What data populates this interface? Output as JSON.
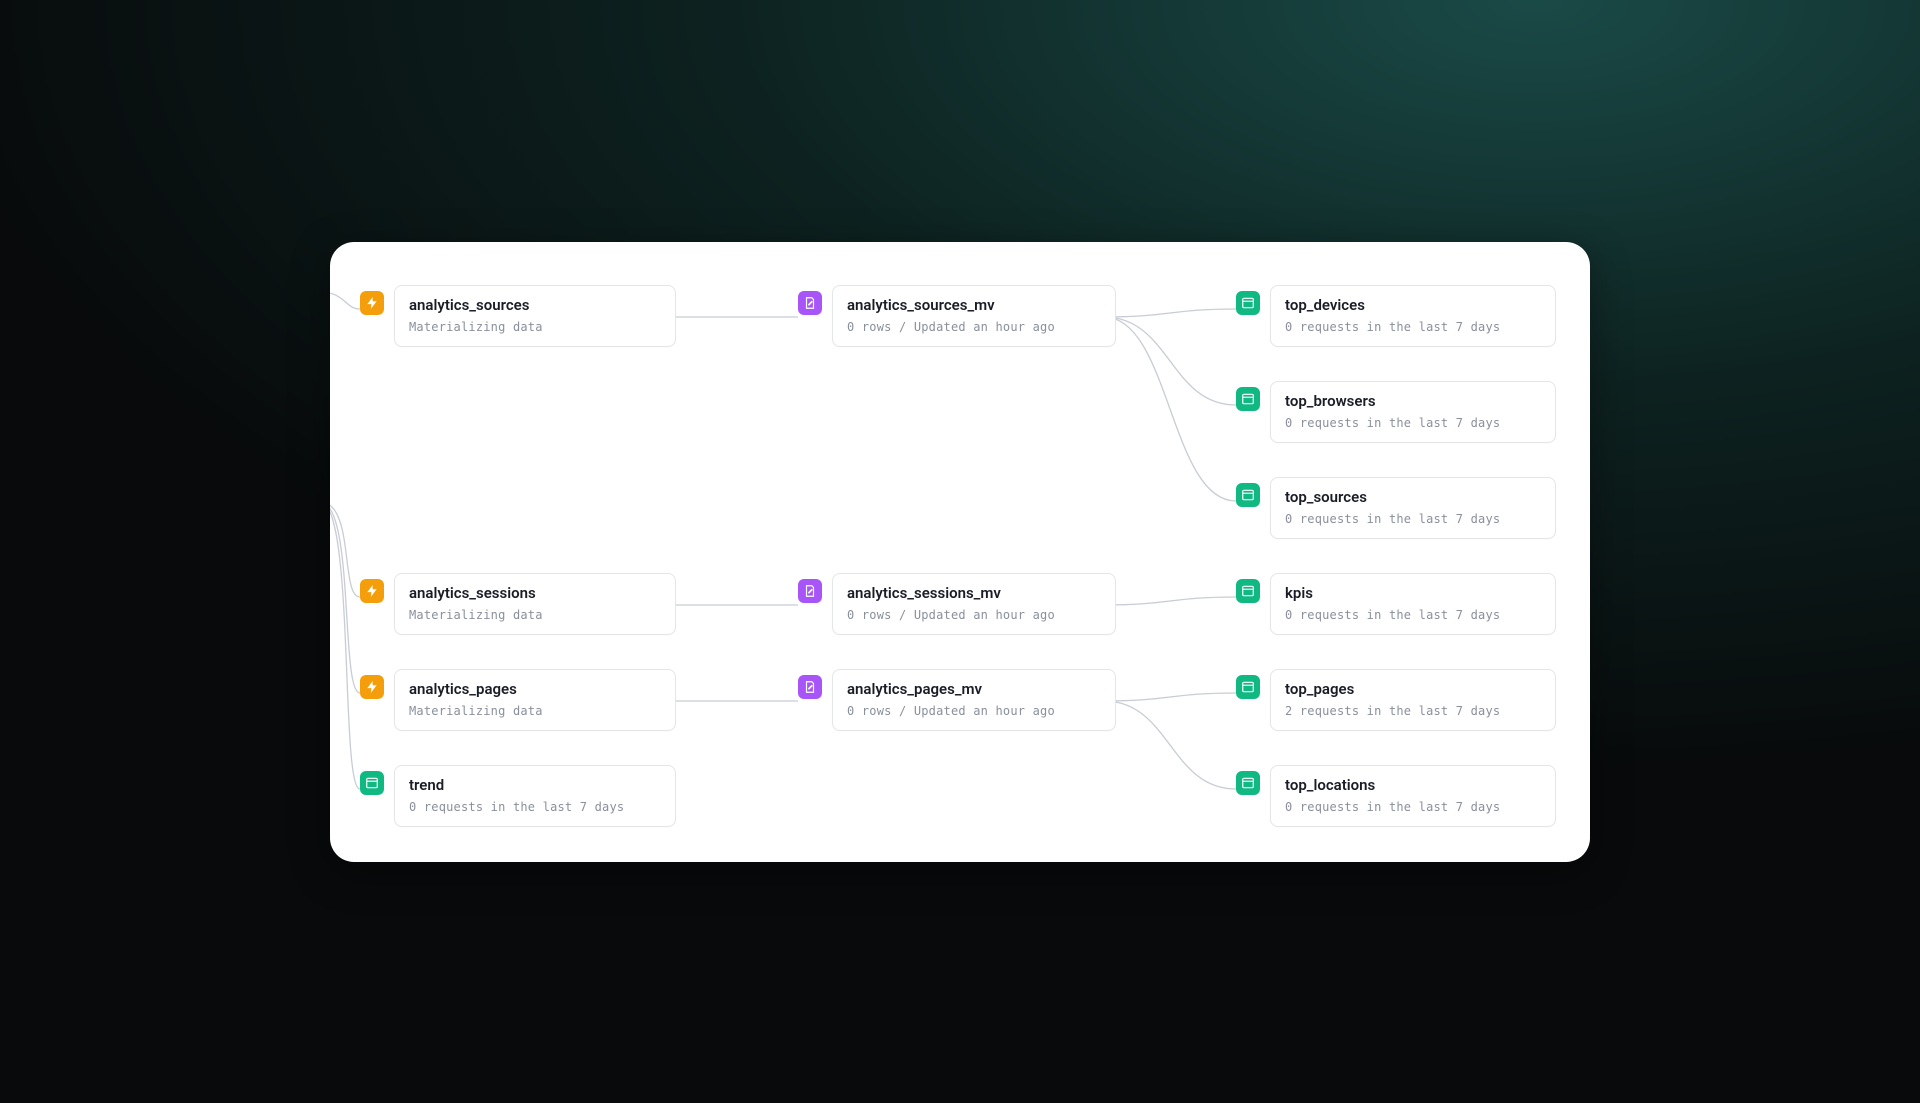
{
  "col1": {
    "analytics_sources": {
      "title": "analytics_sources",
      "subtitle": "Materializing data"
    },
    "analytics_sessions": {
      "title": "analytics_sessions",
      "subtitle": "Materializing data"
    },
    "analytics_pages": {
      "title": "analytics_pages",
      "subtitle": "Materializing data"
    },
    "trend": {
      "title": "trend",
      "subtitle": "0 requests in the last 7 days"
    }
  },
  "col2": {
    "analytics_sources_mv": {
      "title": "analytics_sources_mv",
      "subtitle": "0 rows / Updated an hour ago"
    },
    "analytics_sessions_mv": {
      "title": "analytics_sessions_mv",
      "subtitle": "0 rows / Updated an hour ago"
    },
    "analytics_pages_mv": {
      "title": "analytics_pages_mv",
      "subtitle": "0 rows / Updated an hour ago"
    }
  },
  "col3": {
    "top_devices": {
      "title": "top_devices",
      "subtitle": "0 requests in the last 7 days"
    },
    "top_browsers": {
      "title": "top_browsers",
      "subtitle": "0 requests in the last 7 days"
    },
    "top_sources": {
      "title": "top_sources",
      "subtitle": "0 requests in the last 7 days"
    },
    "kpis": {
      "title": "kpis",
      "subtitle": "0 requests in the last 7 days"
    },
    "top_pages": {
      "title": "top_pages",
      "subtitle": "2 requests in the last 7 days"
    },
    "top_locations": {
      "title": "top_locations",
      "subtitle": "0 requests in the last 7 days"
    }
  }
}
